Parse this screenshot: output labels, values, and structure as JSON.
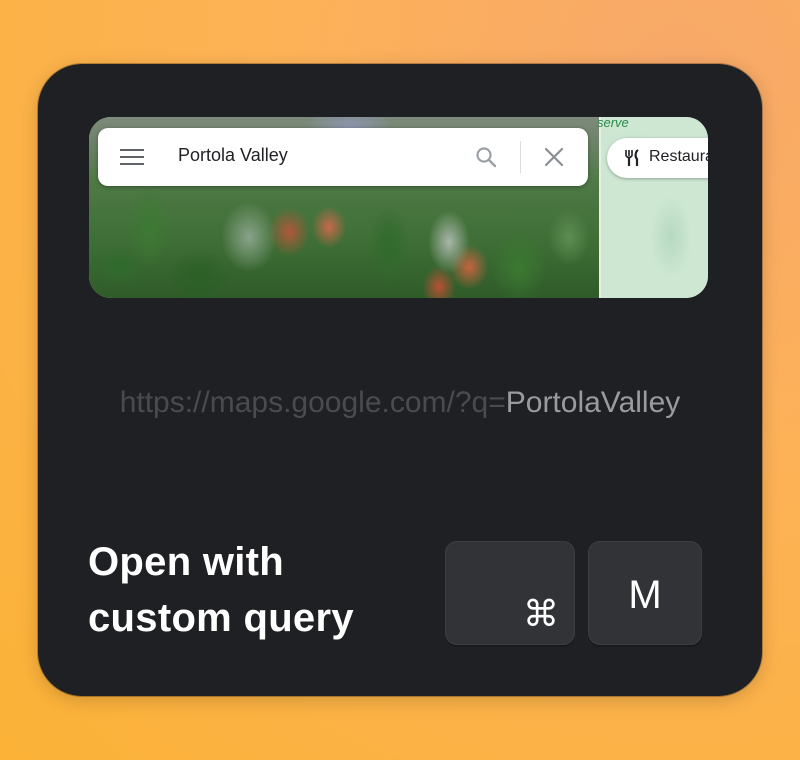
{
  "preview": {
    "search": {
      "value": "Portola Valley",
      "menu_icon": "hamburger-menu-icon",
      "search_icon": "magnifier-icon",
      "clear_icon": "close-icon"
    },
    "map_label": "serve",
    "chip": {
      "label": "Restaurants",
      "icon": "fork-knife-icon"
    }
  },
  "url": {
    "prefix": "https://maps.google.com/?q=",
    "query": "PortolaValley"
  },
  "caption": {
    "line1": "Open with",
    "line2": "custom query"
  },
  "shortcut": {
    "keys": [
      "⌘",
      "M"
    ]
  },
  "colors": {
    "background_gradient": [
      "#f7a86a",
      "#fbb236"
    ],
    "card": "#1f2023",
    "key": "#323336",
    "url_prefix": "#4a4b4e",
    "url_query": "#9a9ba0"
  }
}
